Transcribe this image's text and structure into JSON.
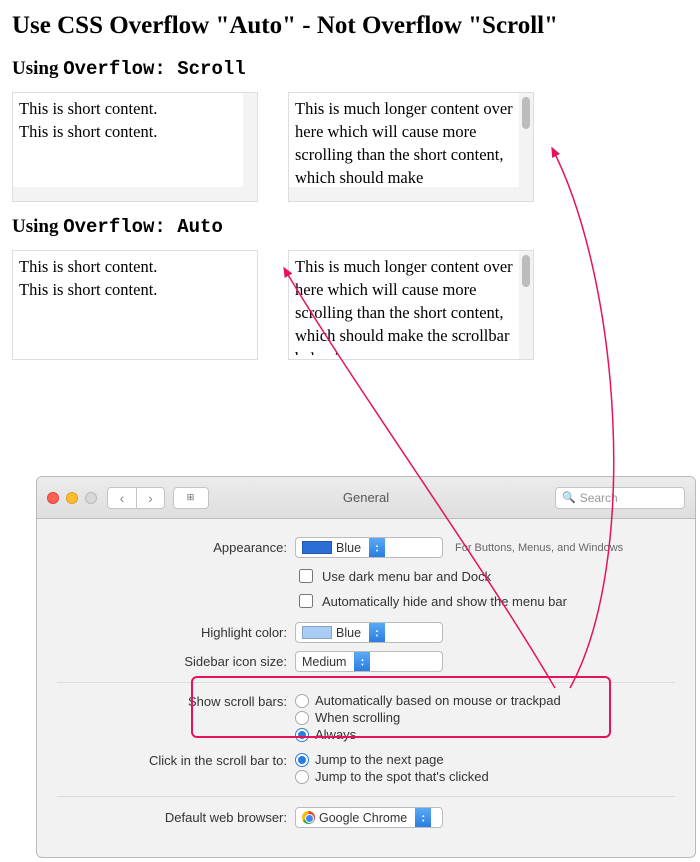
{
  "title": "Use CSS Overflow \"Auto\" - Not Overflow \"Scroll\"",
  "section1": {
    "heading_prefix": "Using ",
    "heading_code": "Overflow: Scroll",
    "box_short": "This is short content.\nThis is short content.",
    "box_long": "This is much longer content over here which will cause more scrolling than the short content, which should make"
  },
  "section2": {
    "heading_prefix": "Using ",
    "heading_code": "Overflow: Auto",
    "box_short": "This is short content.\nThis is short content.",
    "box_long": "This is much longer content over here which will cause more scrolling than the short content, which should make the scrollbar behavior more"
  },
  "mac": {
    "title": "General",
    "search_placeholder": "Search",
    "appearance_label": "Appearance:",
    "appearance_value": "Blue",
    "appearance_hint": "For Buttons, Menus, and Windows",
    "dark_menu": "Use dark menu bar and Dock",
    "auto_hide_menu": "Automatically hide and show the menu bar",
    "highlight_label": "Highlight color:",
    "highlight_value": "Blue",
    "sidebar_label": "Sidebar icon size:",
    "sidebar_value": "Medium",
    "scrollbars_label": "Show scroll bars:",
    "scrollbars_opt1": "Automatically based on mouse or trackpad",
    "scrollbars_opt2": "When scrolling",
    "scrollbars_opt3": "Always",
    "click_label": "Click in the scroll bar to:",
    "click_opt1": "Jump to the next page",
    "click_opt2": "Jump to the spot that's clicked",
    "browser_label": "Default web browser:",
    "browser_value": "Google Chrome"
  },
  "colors": {
    "blue_swatch": "#2b6fd6",
    "highlight_swatch": "#a9cdf5",
    "annotation": "#e6135b"
  }
}
